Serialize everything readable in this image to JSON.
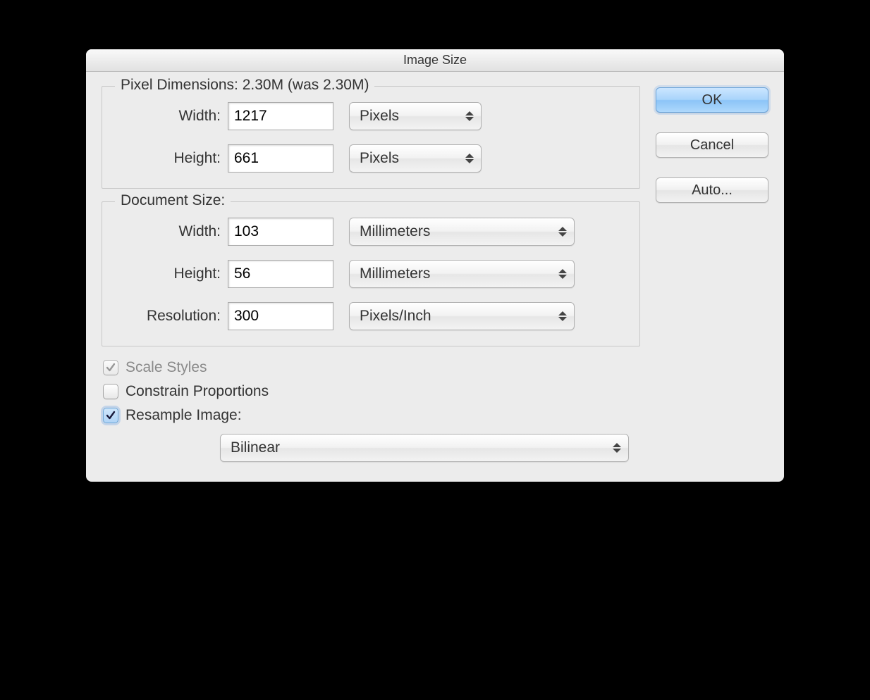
{
  "window": {
    "title": "Image Size"
  },
  "pixel_dimensions": {
    "legend": "Pixel Dimensions:  2.30M (was 2.30M)",
    "width_label": "Width:",
    "width_value": "1217",
    "width_unit": "Pixels",
    "height_label": "Height:",
    "height_value": "661",
    "height_unit": "Pixels"
  },
  "document_size": {
    "legend": "Document Size:",
    "width_label": "Width:",
    "width_value": "103",
    "width_unit": "Millimeters",
    "height_label": "Height:",
    "height_value": "56",
    "height_unit": "Millimeters",
    "resolution_label": "Resolution:",
    "resolution_value": "300",
    "resolution_unit": "Pixels/Inch"
  },
  "options": {
    "scale_styles_label": "Scale Styles",
    "scale_styles_checked": true,
    "constrain_label": "Constrain Proportions",
    "constrain_checked": false,
    "resample_label": "Resample Image:",
    "resample_checked": true,
    "resample_method": "Bilinear"
  },
  "buttons": {
    "ok": "OK",
    "cancel": "Cancel",
    "auto": "Auto..."
  }
}
